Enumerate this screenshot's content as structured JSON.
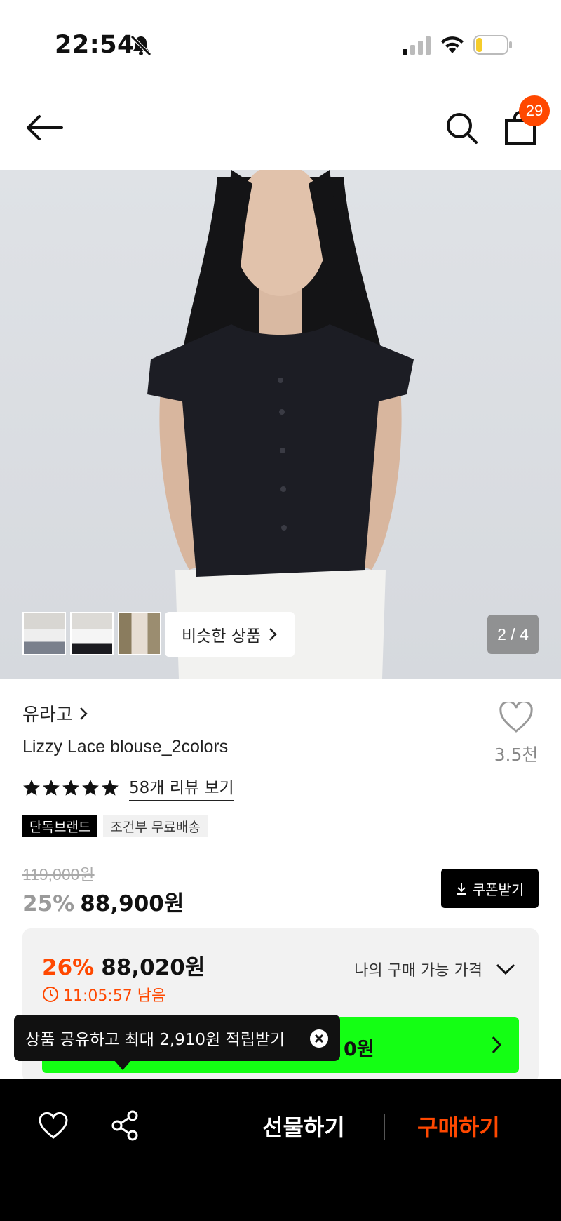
{
  "status_bar": {
    "time": "22:54"
  },
  "header": {
    "cart_count": "29"
  },
  "gallery": {
    "similar_label": "비슷한 상품",
    "page_indicator": "2 / 4"
  },
  "product": {
    "brand": "유라고",
    "name": "Lizzy Lace blouse_2colors",
    "like_count": "3.5천",
    "review_link": "58개 리뷰 보기",
    "rating": 5,
    "tags": [
      "단독브랜드",
      "조건부 무료배송"
    ],
    "original_price": "119,000원",
    "discount": "25%",
    "price": "88,900원",
    "coupon_label": "쿠폰받기"
  },
  "best_price": {
    "discount": "26%",
    "price": "88,020원",
    "timer": "11:05:57 남음",
    "my_price_label": "나의 구매 가능 가격",
    "green_text": "0원"
  },
  "tooltip": {
    "text": "상품 공유하고 최대 2,910원 적립받기"
  },
  "bottom_bar": {
    "gift_label": "선물하기",
    "buy_label": "구매하기"
  },
  "colors": {
    "accent": "#ff4800",
    "green": "#14ff14"
  }
}
